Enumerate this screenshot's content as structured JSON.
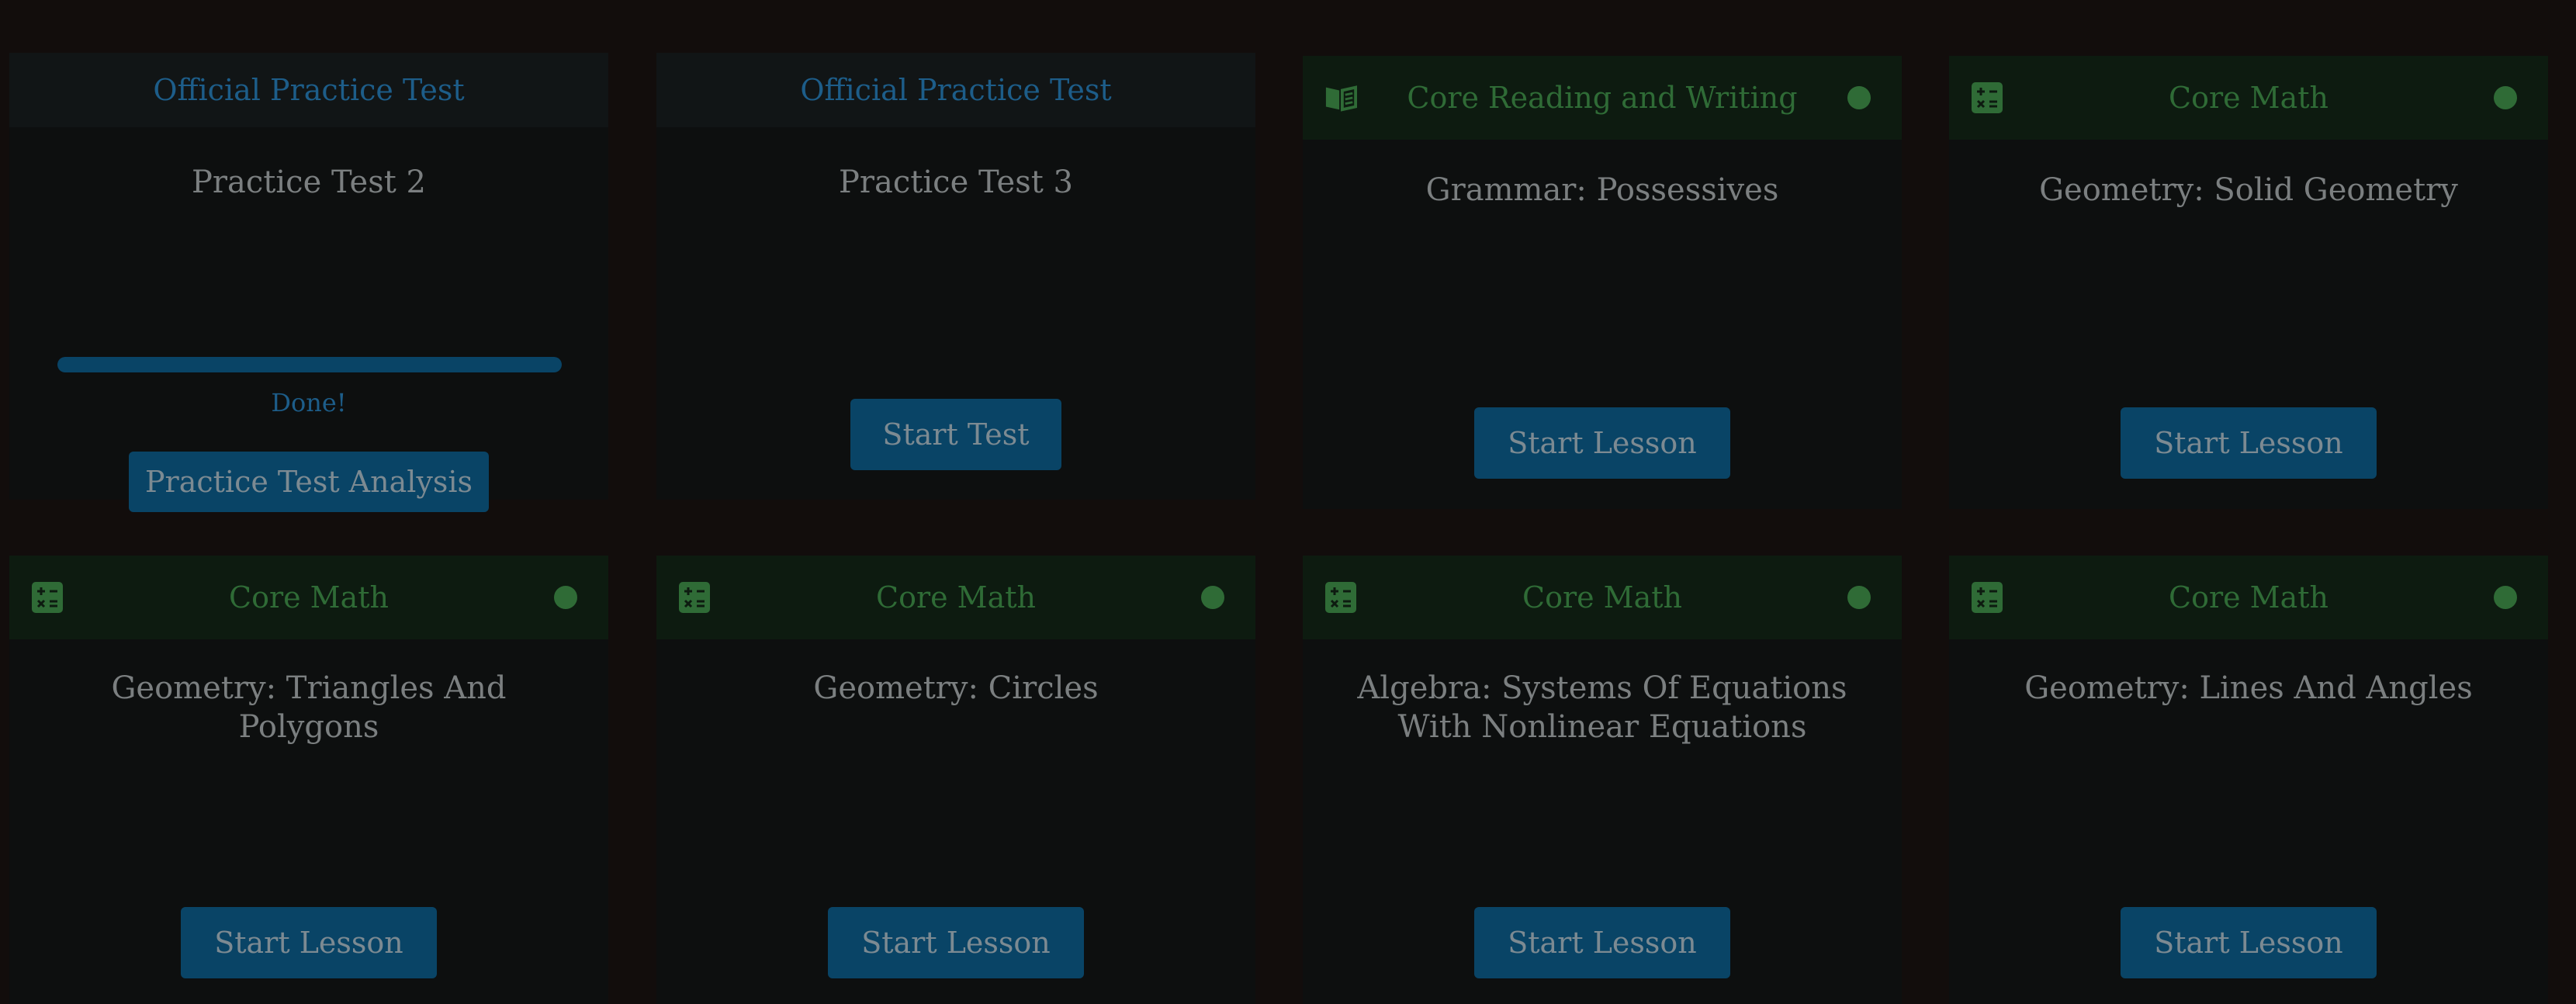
{
  "colors": {
    "page_background": "#120d0c",
    "card_background": "#0d0f0f",
    "official_header_background": "#111516",
    "official_header_text": "#1d5d89",
    "core_header_background": "#0d1b10",
    "core_header_text": "#2f6b36",
    "button_background": "#094466",
    "button_text": "#7c8a92",
    "title_text": "#7b7f80"
  },
  "cards": [
    {
      "kind": "official",
      "header": "Official Practice Test",
      "title": "Practice Test 2",
      "progress": 1.0,
      "progress_label": "Done!",
      "button": "Practice Test Analysis"
    },
    {
      "kind": "official",
      "header": "Official Practice Test",
      "title": "Practice Test 3",
      "button": "Start Test"
    },
    {
      "kind": "core",
      "icon": "open-book-icon",
      "header": "Core Reading and Writing",
      "title": "Grammar: Possessives",
      "button": "Start Lesson"
    },
    {
      "kind": "core",
      "icon": "calculator-icon",
      "header": "Core Math",
      "title": "Geometry: Solid Geometry",
      "button": "Start Lesson"
    },
    {
      "kind": "core",
      "icon": "calculator-icon",
      "header": "Core Math",
      "title": "Geometry: Triangles And Polygons",
      "button": "Start Lesson"
    },
    {
      "kind": "core",
      "icon": "calculator-icon",
      "header": "Core Math",
      "title": "Geometry: Circles",
      "button": "Start Lesson"
    },
    {
      "kind": "core",
      "icon": "calculator-icon",
      "header": "Core Math",
      "title": "Algebra: Systems Of Equations With Nonlinear Equations",
      "button": "Start Lesson"
    },
    {
      "kind": "core",
      "icon": "calculator-icon",
      "header": "Core Math",
      "title": "Geometry: Lines And Angles",
      "button": "Start Lesson"
    }
  ]
}
